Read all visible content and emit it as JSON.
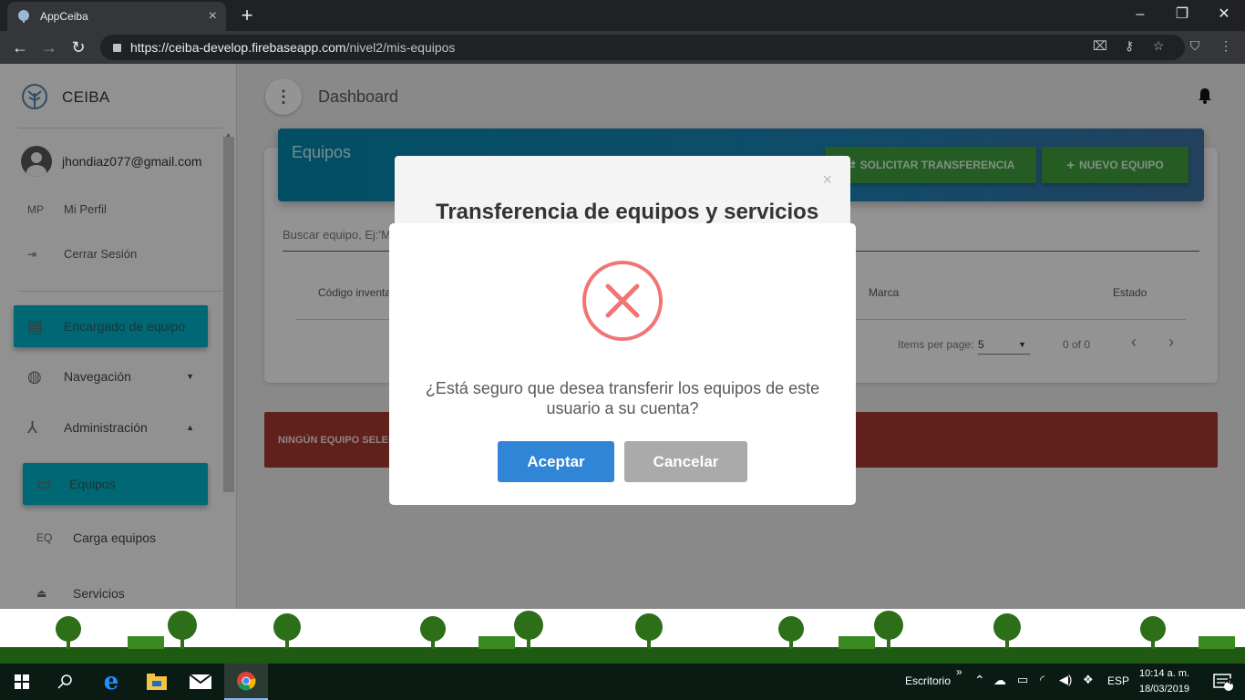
{
  "browser": {
    "tab_title": "AppCeiba",
    "tab_close": "×",
    "new_tab": "+",
    "url_host": "https://ceiba-develop.firebaseapp.com",
    "url_path": "/nivel2/mis-equipos"
  },
  "sidebar": {
    "brand": "CEIBA",
    "user_email": "jhondiaz077@gmail.com",
    "profile_abbr": "MP",
    "profile_label": "Mi Perfil",
    "logout_label": "Cerrar Sesión",
    "items": [
      {
        "label": "Encargado de equipo"
      },
      {
        "label": "Navegación"
      },
      {
        "label": "Administración"
      },
      {
        "label": "Equipos"
      },
      {
        "abbr": "EQ",
        "label": "Carga equipos"
      },
      {
        "label": "Servicios"
      }
    ]
  },
  "header": {
    "title": "Dashboard"
  },
  "card": {
    "title": "Equipos",
    "transfer_button": "SOLICITAR TRANSFERENCIA",
    "new_button": "NUEVO EQUIPO",
    "search_placeholder": "Buscar equipo, Ej:'M",
    "columns": [
      "Código inventa",
      "Marca",
      "Estado"
    ],
    "items_per_page_label": "Items per page:",
    "items_per_page_value": "5",
    "range": "0 of 0"
  },
  "alert": {
    "text": "NINGÚN EQUIPO SELEC"
  },
  "back_dialog": {
    "title": "Transferencia de equipos y servicios",
    "close": "×"
  },
  "modal": {
    "message": "¿Está seguro que desea transferir los equipos de este usuario a su cuenta?",
    "confirm": "Aceptar",
    "cancel": "Cancelar",
    "confirm_color": "#3085d6",
    "cancel_color": "#aaaaaa",
    "icon_color": "#f27474"
  },
  "taskbar": {
    "desktop": "Escritorio",
    "chevron": "»",
    "lang": "ESP",
    "time": "10:14 a. m.",
    "date": "18/03/2019",
    "notif_count": "4"
  },
  "colors": {
    "accent": "#00acc1",
    "header": "#0383a8",
    "green": "#3c9a3c",
    "alert": "#a0362e"
  }
}
